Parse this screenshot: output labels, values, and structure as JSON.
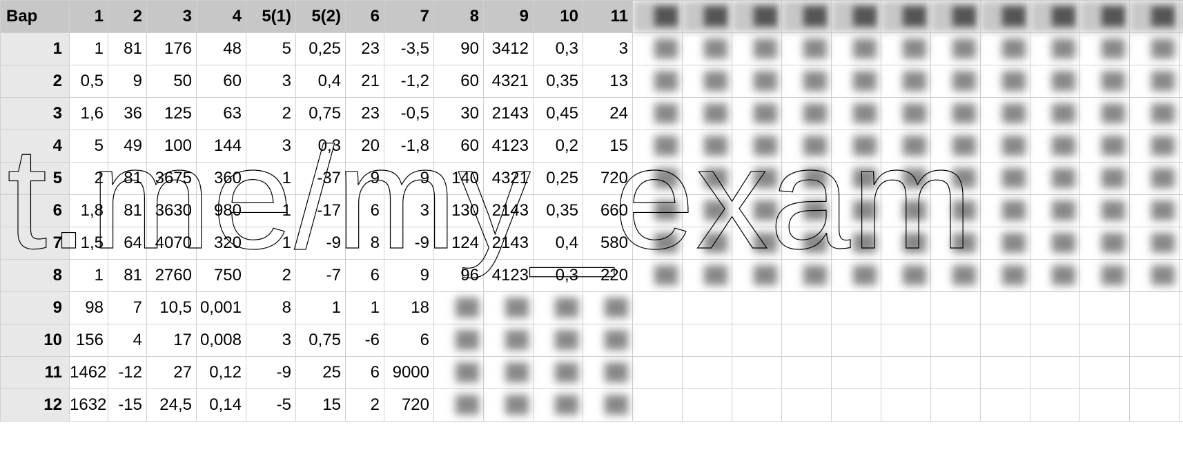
{
  "table": {
    "corner_label": "Вар",
    "column_headers": [
      "1",
      "2",
      "3",
      "4",
      "5(1)",
      "5(2)",
      "6",
      "7",
      "8",
      "9",
      "10",
      "11"
    ],
    "obscured_header_count": 13,
    "rows": [
      {
        "n": "1",
        "cells": [
          "1",
          "81",
          "176",
          "48",
          "5",
          "0,25",
          "23",
          "-3,5",
          "90",
          "3412",
          "0,3",
          "3"
        ],
        "obscured": 12
      },
      {
        "n": "2",
        "cells": [
          "0,5",
          "9",
          "50",
          "60",
          "3",
          "0,4",
          "21",
          "-1,2",
          "60",
          "4321",
          "0,35",
          "13"
        ],
        "obscured": 12
      },
      {
        "n": "3",
        "cells": [
          "1,6",
          "36",
          "125",
          "63",
          "2",
          "0,75",
          "23",
          "-0,5",
          "30",
          "2143",
          "0,45",
          "24"
        ],
        "obscured": 12
      },
      {
        "n": "4",
        "cells": [
          "5",
          "49",
          "100",
          "144",
          "3",
          "0,3",
          "20",
          "-1,8",
          "60",
          "4123",
          "0,2",
          "15"
        ],
        "obscured": 12
      },
      {
        "n": "5",
        "cells": [
          "2",
          "81",
          "3675",
          "360",
          "1",
          "-37",
          "9",
          "9",
          "140",
          "4321",
          "0,25",
          "720"
        ],
        "obscured": 12
      },
      {
        "n": "6",
        "cells": [
          "1,8",
          "81",
          "3630",
          "980",
          "1",
          "-17",
          "6",
          "3",
          "130",
          "2143",
          "0,35",
          "660"
        ],
        "obscured": 12
      },
      {
        "n": "7",
        "cells": [
          "1,5",
          "64",
          "4070",
          "320",
          "1",
          "-9",
          "8",
          "-9",
          "124",
          "2143",
          "0,4",
          "580"
        ],
        "obscured": 12
      },
      {
        "n": "8",
        "cells": [
          "1",
          "81",
          "2760",
          "750",
          "2",
          "-7",
          "6",
          "9",
          "96",
          "4123",
          "0,3",
          "220"
        ],
        "obscured": 12
      },
      {
        "n": "9",
        "cells": [
          "98",
          "7",
          "10,5",
          "0,001",
          "8",
          "1",
          "1",
          "18"
        ],
        "obscured": 4,
        "trailing_empty": 12
      },
      {
        "n": "10",
        "cells": [
          "156",
          "4",
          "17",
          "0,008",
          "3",
          "0,75",
          "-6",
          "6"
        ],
        "obscured": 4,
        "trailing_empty": 12
      },
      {
        "n": "11",
        "cells": [
          "1462",
          "-12",
          "27",
          "0,12",
          "-9",
          "25",
          "6",
          "9000"
        ],
        "obscured": 4,
        "trailing_empty": 12
      },
      {
        "n": "12",
        "cells": [
          "1632",
          "-15",
          "24,5",
          "0,14",
          "-5",
          "15",
          "2",
          "720"
        ],
        "obscured": 4,
        "trailing_empty": 12
      }
    ]
  },
  "watermark_text": "t.me/my_exam"
}
